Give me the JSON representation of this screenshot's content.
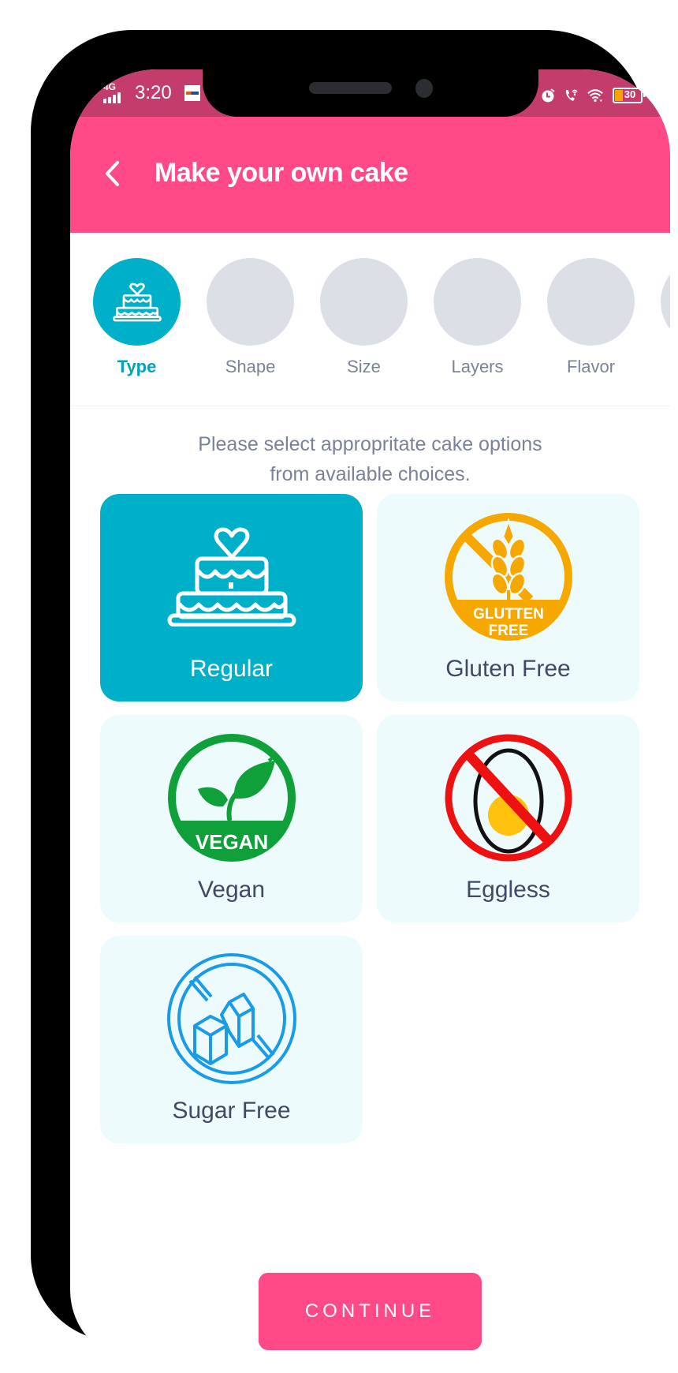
{
  "status_bar": {
    "network": "4G",
    "time": "3:20",
    "battery_level": "30",
    "battery_fraction": 0.3,
    "icons": [
      "signal-icon",
      "carrier-badge-icon",
      "alarm-icon",
      "wifi-calling-icon",
      "wifi-icon",
      "battery-icon"
    ]
  },
  "appbar": {
    "back_icon": "chevron-left-icon",
    "title": "Make your own cake"
  },
  "steps": [
    {
      "label": "Type",
      "active": true,
      "icon": "cake-icon"
    },
    {
      "label": "Shape",
      "active": false
    },
    {
      "label": "Size",
      "active": false
    },
    {
      "label": "Layers",
      "active": false
    },
    {
      "label": "Flavor",
      "active": false
    },
    {
      "label": "",
      "active": false
    }
  ],
  "instructions": {
    "line1": "Please select appropritate cake options",
    "line2": "from available choices."
  },
  "options": [
    {
      "label": "Regular",
      "selected": true,
      "icon": "cake-icon"
    },
    {
      "label": "Gluten Free",
      "selected": false,
      "icon": "gluten-free-icon",
      "badge_line1": "GLUTTEN",
      "badge_line2": "FREE"
    },
    {
      "label": "Vegan",
      "selected": false,
      "icon": "vegan-icon",
      "badge_text": "VEGAN"
    },
    {
      "label": "Eggless",
      "selected": false,
      "icon": "no-egg-icon"
    },
    {
      "label": "Sugar Free",
      "selected": false,
      "icon": "no-sugar-icon"
    }
  ],
  "colors": {
    "primary_pink": "#ff4a87",
    "status_bar": "#c43c6b",
    "accent_teal": "#00b0c8",
    "card_bg": "#eefbfc",
    "inactive_step": "#dcdfe5",
    "gluten_orange": "#f7a800",
    "vegan_green": "#0fa03a",
    "egg_red": "#ee1111",
    "sugar_blue": "#1a9be8"
  },
  "continue_button": {
    "label": "CONTINUE"
  }
}
